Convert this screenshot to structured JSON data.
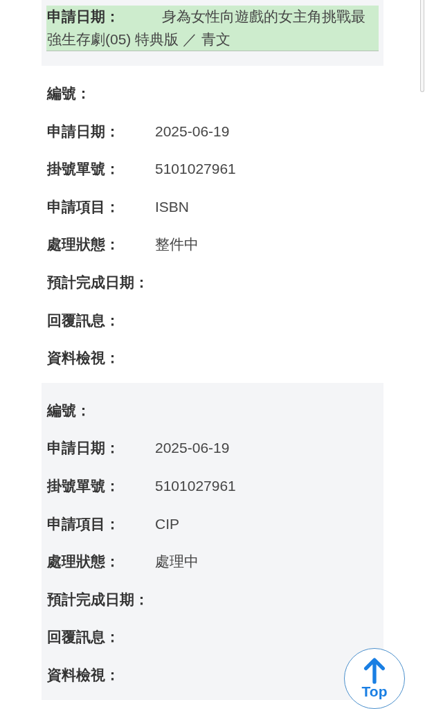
{
  "records": [
    {
      "fields": [
        {
          "label": "申請日期：",
          "value": "身為女性向遊戲的女主角挑戰最強生存劇(05) 特典版 ／ 青文",
          "highlighted": true
        }
      ]
    },
    {
      "fields": [
        {
          "label": "編號：",
          "highlighted": false
        },
        {
          "label": "申請日期：",
          "value": "2025-06-19",
          "highlighted": false
        },
        {
          "label": "掛號單號：",
          "value": "5101027961",
          "highlighted": false
        },
        {
          "label": "申請項目：",
          "value": "ISBN",
          "highlighted": false
        },
        {
          "label": "處理狀態：",
          "value": "整件中",
          "highlighted": false
        },
        {
          "label": "預計完成日期：",
          "highlighted": false
        },
        {
          "label": "回覆訊息：",
          "highlighted": false
        },
        {
          "label": "資料檢視：",
          "highlighted": false
        }
      ]
    },
    {
      "fields": [
        {
          "label": "編號：",
          "highlighted": false
        },
        {
          "label": "申請日期：",
          "value": "2025-06-19",
          "highlighted": false
        },
        {
          "label": "掛號單號：",
          "value": "5101027961",
          "highlighted": false
        },
        {
          "label": "申請項目：",
          "value": "CIP",
          "highlighted": false
        },
        {
          "label": "處理狀態：",
          "value": "處理中",
          "highlighted": false
        },
        {
          "label": "預計完成日期：",
          "highlighted": false
        },
        {
          "label": "回覆訊息：",
          "highlighted": false
        },
        {
          "label": "資料檢視：",
          "highlighted": false
        }
      ]
    }
  ],
  "top_button": {
    "label": "Top"
  }
}
